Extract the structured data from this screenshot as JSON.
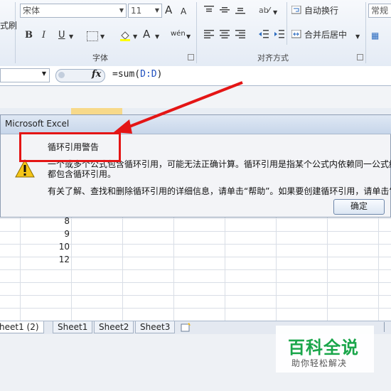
{
  "ribbon": {
    "font_name": "宋体",
    "font_size": "11",
    "left_label": "式刷",
    "grow_font": "A",
    "shrink_font": "A",
    "bold": "B",
    "italic": "I",
    "underline": "U",
    "font_color": "A",
    "phonetic": "wén",
    "wrap_text": "自动换行",
    "merge_center": "合并后居中",
    "number_format": "常规",
    "group_font": "字体",
    "group_alignment": "对齐方式"
  },
  "formula_bar": {
    "fx": "fx",
    "formula_prefix": "=sum(",
    "formula_ref": "D:D",
    "formula_suffix": ")"
  },
  "grid": {
    "values": [
      "8",
      "9",
      "10",
      "12"
    ]
  },
  "dialog": {
    "title": "Microsoft Excel",
    "heading": "循环引用警告",
    "line1": "一个或多个公式包含循环引用，可能无法正确计算。循环引用是指某个公式内依赖同一公式结果",
    "line2": "都包含循环引用。",
    "line3": "有关了解、查找和删除循环引用的详细信息，请单击“帮助”。如果要创建循环引用，请单击“确",
    "ok": "确定"
  },
  "sheets": {
    "tabs": [
      "heet1 (2)",
      "Sheet1",
      "Sheet2",
      "Sheet3"
    ]
  },
  "watermark": {
    "title": "百科全说",
    "subtitle": "助你轻松解决"
  },
  "colors": {
    "accent_red": "#e41515",
    "watermark_green": "#1aa64a",
    "formula_ref_blue": "#1f4fbf"
  }
}
